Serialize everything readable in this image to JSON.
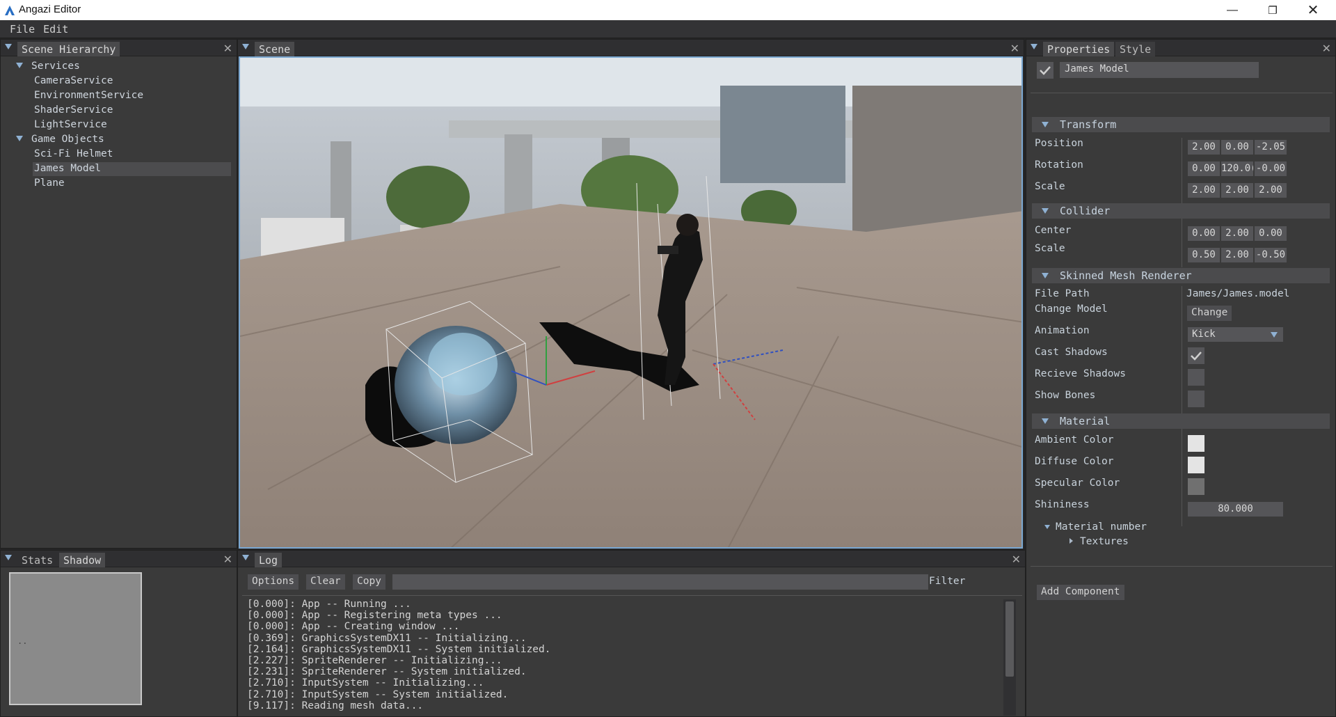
{
  "window": {
    "title": "Angazi Editor",
    "minimize_icon": "minus",
    "maximize_icon": "restore",
    "close_icon": "close"
  },
  "menu": {
    "items": [
      "File",
      "Edit"
    ]
  },
  "hierarchy": {
    "tab": "Scene Hierarchy",
    "groups": [
      {
        "label": "Services",
        "children": [
          "CameraService",
          "EnvironmentService",
          "ShaderService",
          "LightService"
        ]
      },
      {
        "label": "Game Objects",
        "children": [
          "Sci-Fi Helmet",
          "James Model",
          "Plane"
        ]
      }
    ],
    "selected": "James Model"
  },
  "scene": {
    "tab": "Scene"
  },
  "stats": {
    "tabs": [
      "Stats",
      "Shadow"
    ],
    "active_tab": "Shadow",
    "preview_text": ".."
  },
  "log": {
    "tab": "Log",
    "buttons": [
      "Options",
      "Clear",
      "Copy"
    ],
    "filter_label": "Filter",
    "filter_value": "",
    "lines": [
      "[0.000]: App -- Running ...",
      "[0.000]: App -- Registering meta types ...",
      "[0.000]: App -- Creating window ...",
      "[0.369]: GraphicsSystemDX11 -- Initializing...",
      "[2.164]: GraphicsSystemDX11 -- System initialized.",
      "[2.227]: SpriteRenderer -- Initializing...",
      "[2.231]: SpriteRenderer -- System initialized.",
      "[2.710]: InputSystem -- Initializing...",
      "[2.710]: InputSystem -- System initialized.",
      "[9.117]: Reading mesh data..."
    ]
  },
  "properties": {
    "tabs": [
      "Properties",
      "Style"
    ],
    "object_name": "James Model",
    "object_enabled": true,
    "transform": {
      "title": "Transform",
      "position": {
        "label": "Position",
        "values": [
          "2.00",
          "0.00",
          "-2.05"
        ]
      },
      "rotation": {
        "label": "Rotation",
        "values": [
          "0.00",
          "120.0(",
          "-0.00"
        ]
      },
      "scale": {
        "label": "Scale",
        "values": [
          "2.00",
          "2.00",
          "2.00"
        ]
      }
    },
    "collider": {
      "title": "Collider",
      "center": {
        "label": "Center",
        "values": [
          "0.00",
          "2.00",
          "0.00"
        ]
      },
      "scale": {
        "label": "Scale",
        "values": [
          "0.50",
          "2.00",
          "-0.50"
        ]
      }
    },
    "skinned": {
      "title": "Skinned Mesh Renderer",
      "file_path_label": "File Path",
      "file_path": "James/James.model",
      "change_model_label": "Change Model",
      "change_button": "Change",
      "animation_label": "Animation",
      "animation_value": "Kick",
      "cast_shadows_label": "Cast Shadows",
      "cast_shadows": true,
      "receive_shadows_label": "Recieve Shadows",
      "receive_shadows": false,
      "show_bones_label": "Show Bones",
      "show_bones": false
    },
    "material": {
      "title": "Material",
      "ambient_label": "Ambient Color",
      "ambient_color": "#e4e4e4",
      "diffuse_label": "Diffuse Color",
      "diffuse_color": "#e4e4e4",
      "specular_label": "Specular Color",
      "specular_color": "#707070",
      "shininess_label": "Shininess",
      "shininess": "80.000",
      "material_number": "Material number",
      "textures": "Textures"
    },
    "add_component": "Add Component"
  }
}
